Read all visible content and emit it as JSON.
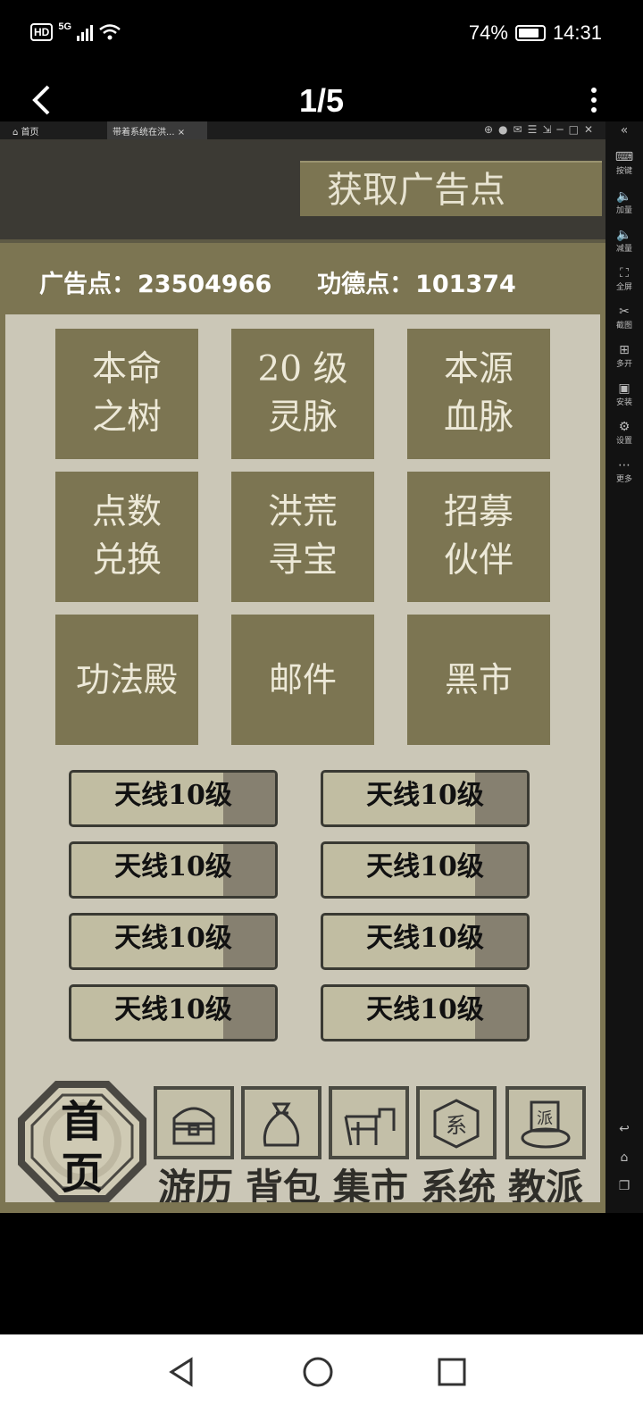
{
  "status_bar": {
    "network": "5G",
    "battery": "74%",
    "time": "14:31"
  },
  "viewer": {
    "pager": "1/5"
  },
  "emulator": {
    "home_tab": "首页",
    "app_tab": "带着系统在洪...",
    "side_buttons": [
      "按键",
      "加量",
      "减量",
      "全屏",
      "截图",
      "多开",
      "安装",
      "设置",
      "更多"
    ]
  },
  "game": {
    "ad_button": "获取广告点",
    "points": {
      "ad_label": "广告点：",
      "ad_value": "23504966",
      "merit_label": "功德点：",
      "merit_value": "101374"
    },
    "tiles": [
      {
        "line1": "本命",
        "line2": "之树"
      },
      {
        "line1": "20 级",
        "line2": "灵脉"
      },
      {
        "line1": "本源",
        "line2": "血脉"
      },
      {
        "line1": "点数",
        "line2": "兑换"
      },
      {
        "line1": "洪荒",
        "line2": "寻宝"
      },
      {
        "line1": "招募",
        "line2": "伙伴"
      },
      {
        "line1": "功法殿",
        "line2": ""
      },
      {
        "line1": "邮件",
        "line2": ""
      },
      {
        "line1": "黑市",
        "line2": ""
      }
    ],
    "small_buttons": [
      "天线10级",
      "天线10级",
      "天线10级",
      "天线10级",
      "天线10级",
      "天线10级",
      "天线10级",
      "天线10级"
    ],
    "home_badge": {
      "line1": "首",
      "line2": "页"
    },
    "nav": [
      "游历",
      "背包",
      "集市",
      "系统",
      "教派"
    ],
    "nav_icons": [
      "chest-icon",
      "bag-icon",
      "stall-icon",
      "system-seal-icon",
      "sect-icon"
    ]
  }
}
